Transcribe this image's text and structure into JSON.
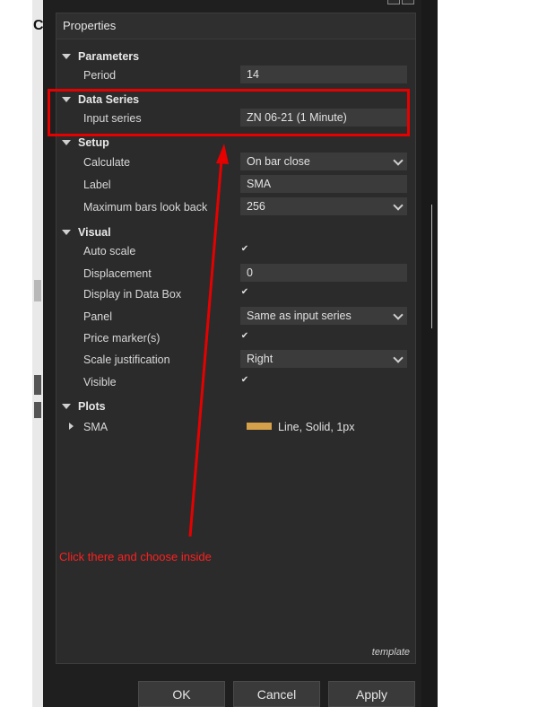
{
  "panel": {
    "title": "Properties",
    "template_label": "template"
  },
  "sections": {
    "parameters": "Parameters",
    "data_series": "Data Series",
    "setup": "Setup",
    "visual": "Visual",
    "plots": "Plots"
  },
  "parameters": {
    "period_label": "Period",
    "period_value": "14"
  },
  "data_series": {
    "input_label": "Input series",
    "input_value": "ZN 06-21 (1 Minute)"
  },
  "setup": {
    "calculate_label": "Calculate",
    "calculate_value": "On bar close",
    "label_label": "Label",
    "label_value": "SMA",
    "max_bars_label": "Maximum bars look back",
    "max_bars_value": "256"
  },
  "visual": {
    "auto_scale_label": "Auto scale",
    "auto_scale_checked": true,
    "displacement_label": "Displacement",
    "displacement_value": "0",
    "data_box_label": "Display in Data Box",
    "data_box_checked": true,
    "panel_label": "Panel",
    "panel_value": "Same as input series",
    "price_marker_label": "Price marker(s)",
    "price_marker_checked": true,
    "scale_just_label": "Scale justification",
    "scale_just_value": "Right",
    "visible_label": "Visible",
    "visible_checked": true
  },
  "plots": {
    "name": "SMA",
    "description": "Line, Solid, 1px",
    "color": "#d4a04a"
  },
  "buttons": {
    "ok": "OK",
    "cancel": "Cancel",
    "apply": "Apply"
  },
  "annotation": {
    "text": "Click there and choose inside",
    "color": "#e60000"
  },
  "icons": {
    "checkmark": "✔"
  }
}
